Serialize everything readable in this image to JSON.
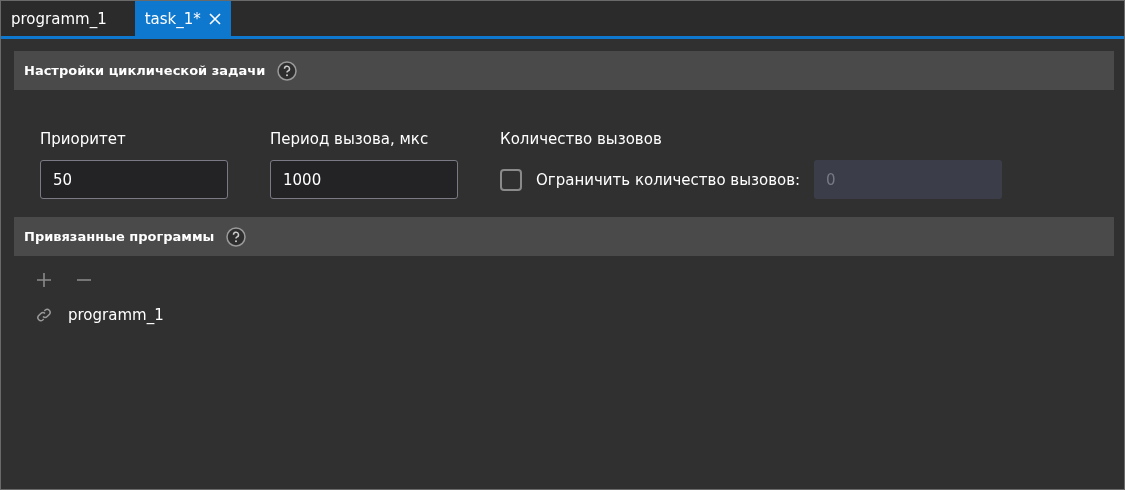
{
  "tabs": [
    {
      "label": "programm_1",
      "selected": false,
      "closable": false
    },
    {
      "label": "task_1*",
      "selected": true,
      "closable": true
    }
  ],
  "settings_section": {
    "title": "Настройки циклической задачи",
    "fields": [
      {
        "kind": "input",
        "label": "Приоритет",
        "value": "50"
      },
      {
        "kind": "input",
        "label": "Период вызова, мкс",
        "value": "1000"
      },
      {
        "kind": "limit",
        "label": "Количество вызовов",
        "checkbox_label": "Ограничить количество вызовов:",
        "checked": false,
        "value": "0",
        "disabled": true
      }
    ]
  },
  "programs_section": {
    "title": "Привязанные программы",
    "items": [
      {
        "name": "programm_1"
      }
    ]
  }
}
